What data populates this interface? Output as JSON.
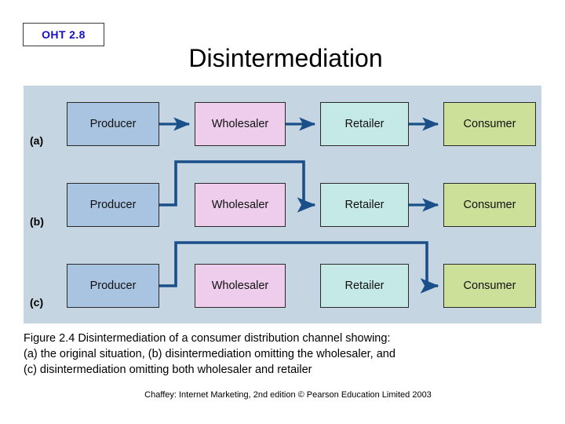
{
  "badge": {
    "label": "OHT 2.8",
    "text_color": "#1510c8"
  },
  "header": {
    "title": "Disintermediation"
  },
  "diagram": {
    "panel_color": "#c5d6e2",
    "arrow_color": "#1b4f8a",
    "node_labels": {
      "producer": "Producer",
      "wholesaler": "Wholesaler",
      "retailer": "Retailer",
      "consumer": "Consumer"
    },
    "node_colors": {
      "producer": "#a8c4e0",
      "wholesaler": "#eecdec",
      "retailer": "#c5e9e6",
      "consumer": "#cde09a"
    },
    "rows": [
      {
        "label": "(a)",
        "description": "the original situation",
        "nodes": [
          "Producer",
          "Wholesaler",
          "Retailer",
          "Consumer"
        ],
        "flow": "Producer -> Wholesaler -> Retailer -> Consumer",
        "bypass": "none"
      },
      {
        "label": "(b)",
        "description": "disintermediation omitting the wholesaler",
        "nodes": [
          "Producer",
          "Wholesaler",
          "Retailer",
          "Consumer"
        ],
        "flow": "Producer -> Retailer -> Consumer",
        "bypass": "wholesaler"
      },
      {
        "label": "(c)",
        "description": "disintermediation omitting both wholesaler and retailer",
        "nodes": [
          "Producer",
          "Wholesaler",
          "Retailer",
          "Consumer"
        ],
        "flow": "Producer -> Consumer",
        "bypass": "wholesaler-and-retailer"
      }
    ]
  },
  "caption": {
    "line1": "Figure 2.4 Disintermediation of a consumer distribution channel showing:",
    "line2": "(a) the original situation, (b) disintermediation omitting the wholesaler, and",
    "line3": "(c) disintermediation omitting both wholesaler and retailer"
  },
  "footer": {
    "credit": "Chaffey: Internet Marketing, 2nd edition © Pearson Education Limited 2003"
  }
}
